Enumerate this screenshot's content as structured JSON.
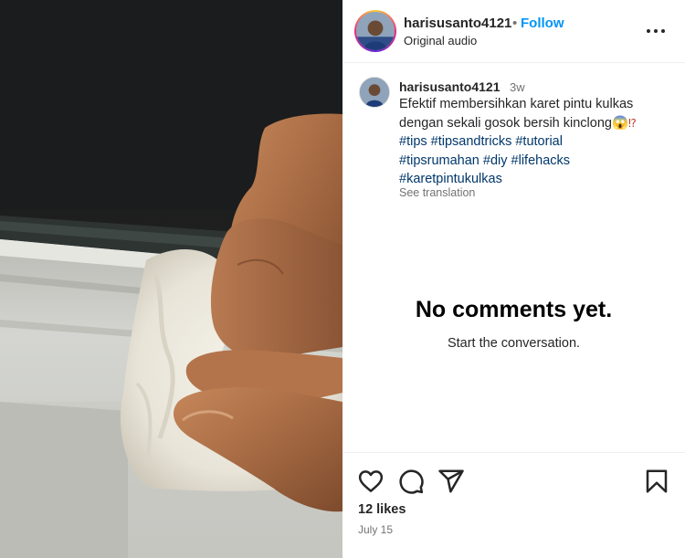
{
  "media": {
    "description_icon": "video-frame"
  },
  "header": {
    "username": "harisusanto4121",
    "separator": "•",
    "follow_label": "Follow",
    "audio_label": "Original audio",
    "more_icon": "more-horizontal-icon"
  },
  "caption": {
    "username": "harisusanto4121",
    "time_ago": "3w",
    "lines": [
      "Efektif membersihkan karet pintu kulkas",
      "dengan sekali gosok bersih kinclong",
      ""
    ],
    "emoji_face": "😱",
    "emoji_mark": "⁉",
    "hashtags_line1": [
      "#tips",
      "#tipsandtricks",
      "#tutorial"
    ],
    "hashtags_line2": [
      "#tipsrumahan",
      "#diy",
      "#lifehacks"
    ],
    "hashtags_line3": [
      "#karetpintukulkas"
    ],
    "see_translation": "See translation"
  },
  "comments": {
    "empty_title": "No comments yet.",
    "empty_subtitle": "Start the conversation."
  },
  "actions": {
    "icons": [
      "heart-icon",
      "comment-icon",
      "share-icon",
      "bookmark-icon"
    ],
    "likes": "12 likes",
    "date": "July 15"
  },
  "colors": {
    "accent": "#0095f6",
    "hashtag": "#00376b",
    "muted": "#737373",
    "text": "#262626"
  }
}
